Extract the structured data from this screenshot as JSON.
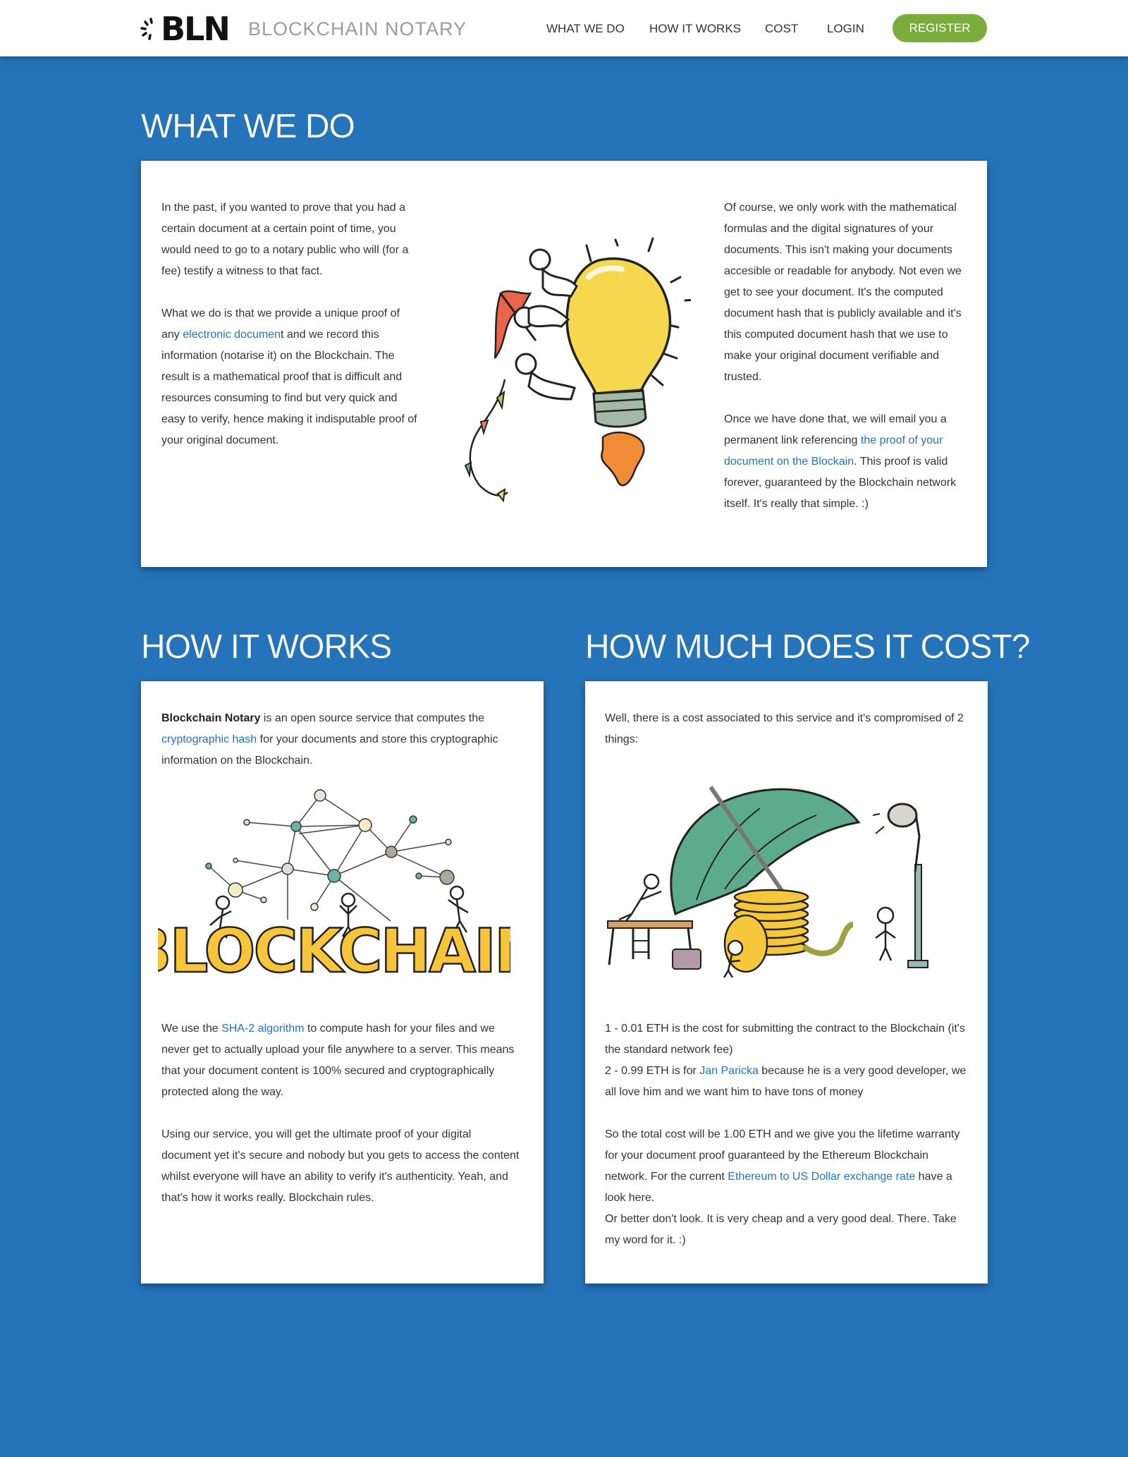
{
  "header": {
    "logo_text": "BLN",
    "brand_name": "BLOCKCHAIN NOTARY",
    "nav": {
      "what_we_do": "WHAT WE DO",
      "how_it_works": "HOW IT WORKS",
      "cost": "COST",
      "login": "LOGIN",
      "register": "REGISTER"
    }
  },
  "what_we_do": {
    "title": "WHAT WE DO",
    "left": {
      "p1": "In the past, if you wanted to prove that you had a certain document at a certain point of time, you would need to go to a notary public who will (for a fee) testify a witness to that fact.",
      "p2_pre": "What we do is that we provide a unique proof of any ",
      "p2_link": "electronic documen",
      "p2_post": "t and we record this information (notarise it) on the Blockchain. The result is a mathematical proof that is difficult and resources consuming to find but very quick and easy to verify, hence making it indisputable proof of your original document."
    },
    "right": {
      "p1": "Of course, we only work with the mathematical formulas and the digital signatures of your documents. This isn't making your documents accesible or readable for anybody. Not even we get to see your document.  It's the computed document hash that is publicly available and it's this computed document hash that we use to make your original document verifiable and trusted.",
      "p2_pre": "Once we have done that, we will email you a permanent link referencing ",
      "p2_link": "the proof of your document on the Blockain",
      "p2_post": ". This proof is valid forever, guaranteed by the Blockchain network itself.  It's really that simple. :)"
    }
  },
  "how_it_works": {
    "title": "HOW IT WORKS",
    "intro_bold": "Blockchain Notary",
    "intro_pre": " is an open source service that computes the ",
    "intro_link": "cryptographic hash",
    "intro_post": " for your documents and store this cryptographic information on the Blockchain.",
    "illustration_word": "BLOCKCHAIN",
    "p2_pre": "We use the ",
    "p2_link": "SHA-2 algorithm",
    "p2_post": " to compute hash for your files and we never get to actually upload your file anywhere to a server. This means that your document content is 100% secured and cryptographically protected along the way.",
    "p3": "Using our service, you will get the ultimate proof of your digital document yet it's secure and nobody but you gets to access the content whilst everyone will have an ability to verify it's authenticity. Yeah, and that's how it works really.  Blockchain rules."
  },
  "cost": {
    "title": "HOW MUCH DOES IT COST?",
    "intro": "Well, there is a cost associated to this service and it's compromised of 2 things:",
    "item1": "1 - 0.01 ETH is the cost for submitting the contract to the Blockchain (it's the standard network fee)",
    "item2_pre": "2 - 0.99 ETH is for ",
    "item2_link": "Jan Paricka",
    "item2_post": " because he is a very good developer, we all love him and we want him to have tons of money",
    "p3_pre": "So the total cost will be 1.00 ETH and we give you the lifetime warranty for your document proof guaranteed by the Ethereum Blockchain network.  For the current ",
    "p3_link": "Ethereum to US Dollar exchange rate",
    "p3_post": " have a look here.",
    "p4": "Or better don't look.  It is very cheap and a very good deal. There. Take my word for it. :)"
  },
  "colors": {
    "background": "#2574b9",
    "register_button": "#7aad3b",
    "link": "#2574b9"
  }
}
